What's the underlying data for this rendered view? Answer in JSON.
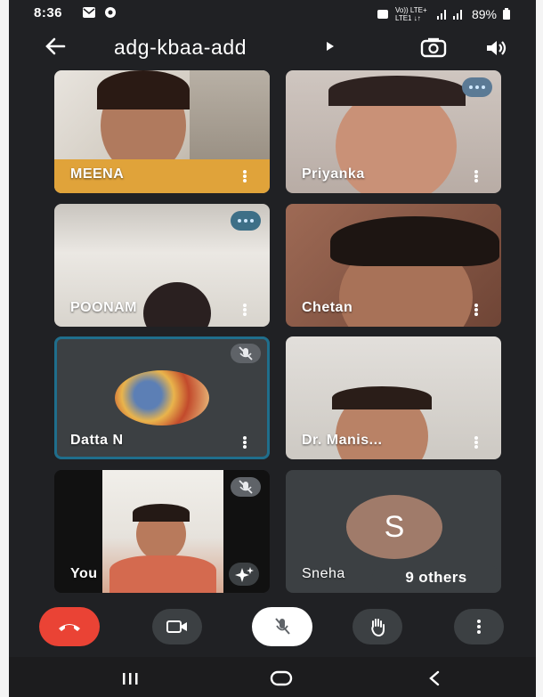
{
  "status_bar": {
    "time": "8:36",
    "network": "Vo)) LTE+ LTE1 ↓↑",
    "battery": "89%"
  },
  "meeting": {
    "code": "adg-kbaa-add"
  },
  "tiles": [
    {
      "name": "MEENA"
    },
    {
      "name": "Priyanka"
    },
    {
      "name": "POONAM"
    },
    {
      "name": "Chetan"
    },
    {
      "name": "Datta N"
    },
    {
      "name": "Dr. Manis..."
    },
    {
      "name": "You"
    },
    {
      "name": "Sneha",
      "avatar_letter": "S"
    }
  ],
  "others_chip": "9 others",
  "colors": {
    "end_call": "#ea4335",
    "background": "#202124",
    "tile": "#3c4043",
    "avatar_s": "#a07b6a"
  }
}
